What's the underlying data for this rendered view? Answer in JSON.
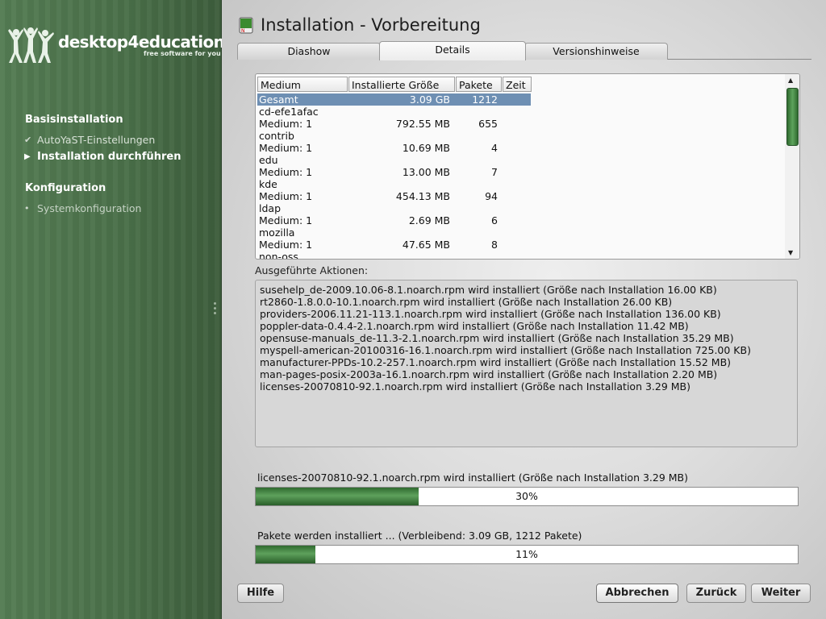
{
  "colors": {
    "sidebar_bg": "#4a7049",
    "accent_green": "#3e7e3d",
    "selection_blue": "#6e8fb3"
  },
  "sidebar": {
    "brand": "desktop4education",
    "tagline": "free software for you",
    "sections": [
      {
        "title": "Basisinstallation",
        "items": [
          {
            "label": "AutoYaST-Einstellungen",
            "state": "done",
            "icon": "check-icon"
          },
          {
            "label": "Installation durchführen",
            "state": "current",
            "icon": "arrow-right-icon"
          }
        ]
      },
      {
        "title": "Konfiguration",
        "items": [
          {
            "label": "Systemkonfiguration",
            "state": "pending",
            "icon": "bullet-icon"
          }
        ]
      }
    ]
  },
  "header": {
    "title": "Installation - Vorbereitung",
    "icon": "package-icon"
  },
  "tabs": [
    {
      "label": "Diashow",
      "active": false
    },
    {
      "label": "Details",
      "active": true
    },
    {
      "label": "Versionshinweise",
      "active": false
    }
  ],
  "media_table": {
    "columns": [
      "Medium",
      "Installierte Größe",
      "Pakete",
      "Zeit"
    ],
    "rows": [
      {
        "type": "total",
        "medium": "Gesamt",
        "size": "3.09 GB",
        "packages": "1212",
        "time": "",
        "selected": true
      },
      {
        "type": "group",
        "medium": "cd-efe1afac"
      },
      {
        "type": "item",
        "medium": "Medium: 1",
        "size": "792.55 MB",
        "packages": "655",
        "time": ""
      },
      {
        "type": "group",
        "medium": "contrib"
      },
      {
        "type": "item",
        "medium": "Medium: 1",
        "size": "10.69 MB",
        "packages": "4",
        "time": ""
      },
      {
        "type": "group",
        "medium": "edu"
      },
      {
        "type": "item",
        "medium": "Medium: 1",
        "size": "13.00 MB",
        "packages": "7",
        "time": ""
      },
      {
        "type": "group",
        "medium": "kde"
      },
      {
        "type": "item",
        "medium": "Medium: 1",
        "size": "454.13 MB",
        "packages": "94",
        "time": ""
      },
      {
        "type": "group",
        "medium": "ldap"
      },
      {
        "type": "item",
        "medium": "Medium: 1",
        "size": "2.69 MB",
        "packages": "6",
        "time": ""
      },
      {
        "type": "group",
        "medium": "mozilla"
      },
      {
        "type": "item",
        "medium": "Medium: 1",
        "size": "47.65 MB",
        "packages": "8",
        "time": ""
      },
      {
        "type": "group",
        "medium": "non-oss"
      }
    ]
  },
  "actions": {
    "label": "Ausgeführte Aktionen:",
    "log": [
      "susehelp_de-2009.10.06-8.1.noarch.rpm wird installiert (Größe nach Installation 16.00 KB)",
      "rt2860-1.8.0.0-10.1.noarch.rpm wird installiert (Größe nach Installation 26.00 KB)",
      "providers-2006.11.21-113.1.noarch.rpm wird installiert (Größe nach Installation 136.00 KB)",
      "poppler-data-0.4.4-2.1.noarch.rpm wird installiert (Größe nach Installation 11.42 MB)",
      "opensuse-manuals_de-11.3-2.1.noarch.rpm wird installiert (Größe nach Installation 35.29 MB)",
      "myspell-american-20100316-16.1.noarch.rpm wird installiert (Größe nach Installation 725.00 KB)",
      "manufacturer-PPDs-10.2-257.1.noarch.rpm wird installiert (Größe nach Installation 15.52 MB)",
      "man-pages-posix-2003a-16.1.noarch.rpm wird installiert (Größe nach Installation 2.20 MB)",
      "licenses-20070810-92.1.noarch.rpm wird installiert (Größe nach Installation 3.29 MB)"
    ]
  },
  "package_progress": {
    "label": "licenses-20070810-92.1.noarch.rpm wird installiert (Größe nach Installation 3.29 MB)",
    "percent": 30,
    "text": "30%"
  },
  "total_progress": {
    "label": "Pakete werden installiert ... (Verbleibend: 3.09 GB,  1212 Pakete)",
    "percent": 11,
    "text": "11%"
  },
  "buttons": {
    "help": "Hilfe",
    "abort": "Abbrechen",
    "back": "Zurück",
    "next": "Weiter"
  }
}
